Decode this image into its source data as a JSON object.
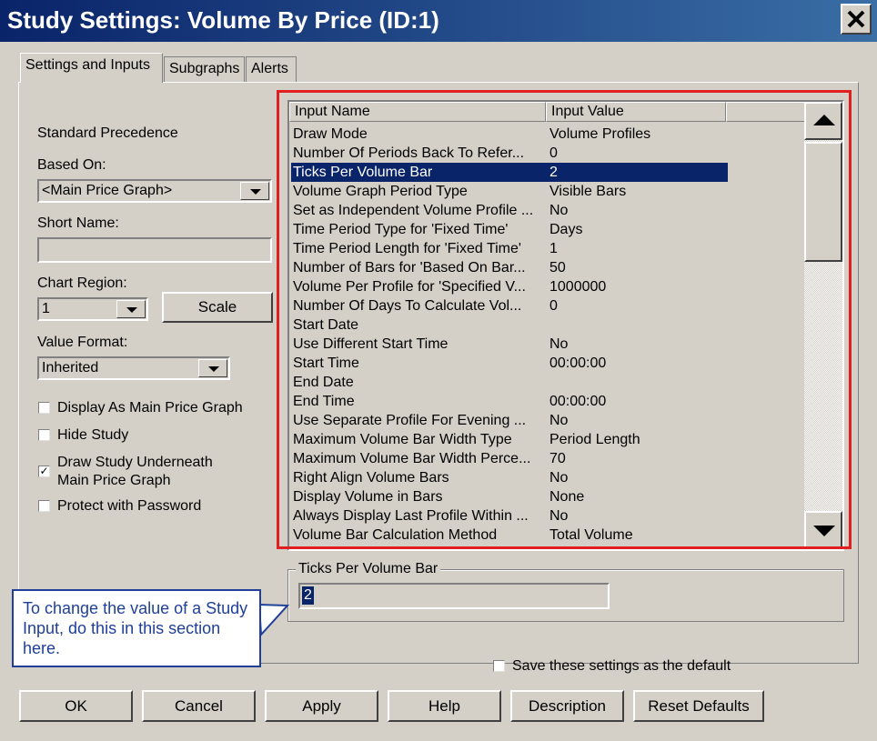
{
  "window": {
    "title": "Study Settings: Volume By Price (ID:1)",
    "close_glyph": "✕"
  },
  "tabs": [
    {
      "label": "Settings and Inputs",
      "active": true
    },
    {
      "label": "Subgraphs",
      "active": false
    },
    {
      "label": "Alerts",
      "active": false
    }
  ],
  "left": {
    "standard_precedence": "Standard Precedence",
    "based_on_label": "Based On:",
    "based_on_value": "<Main Price Graph>",
    "short_name_label": "Short Name:",
    "short_name_value": "",
    "chart_region_label": "Chart Region:",
    "chart_region_value": "1",
    "scale_label": "Scale",
    "value_format_label": "Value Format:",
    "value_format_value": "Inherited",
    "checkboxes": [
      {
        "label": "Display As Main Price Graph",
        "checked": false
      },
      {
        "label": "Hide Study",
        "checked": false
      },
      {
        "label": "Draw Study Underneath",
        "label2": "Main Price Graph",
        "checked": true
      },
      {
        "label": "Protect with Password",
        "checked": false
      }
    ],
    "check_glyph": "✓"
  },
  "grid": {
    "headers": [
      "Input Name",
      "Input Value"
    ],
    "rows": [
      {
        "name": "Draw Mode",
        "value": "Volume Profiles"
      },
      {
        "name": "Number Of Periods Back To Refer...",
        "value": "0"
      },
      {
        "name": "Ticks Per Volume Bar",
        "value": "2",
        "selected": true
      },
      {
        "name": "Volume Graph Period Type",
        "value": "Visible Bars"
      },
      {
        "name": "Set as Independent Volume Profile ...",
        "value": "No"
      },
      {
        "name": "Time Period Type for 'Fixed Time'",
        "value": "Days"
      },
      {
        "name": "Time Period Length for 'Fixed Time'",
        "value": "1"
      },
      {
        "name": "Number of Bars for 'Based On Bar...",
        "value": "50"
      },
      {
        "name": "Volume Per Profile for 'Specified V...",
        "value": "1000000"
      },
      {
        "name": "Number Of Days To Calculate Vol...",
        "value": "0"
      },
      {
        "name": "Start Date",
        "value": ""
      },
      {
        "name": "Use Different Start Time",
        "value": "No"
      },
      {
        "name": "Start Time",
        "value": "00:00:00"
      },
      {
        "name": "End Date",
        "value": ""
      },
      {
        "name": "End Time",
        "value": "00:00:00"
      },
      {
        "name": "Use Separate Profile For Evening ...",
        "value": "No"
      },
      {
        "name": "Maximum Volume Bar Width Type",
        "value": "Period Length"
      },
      {
        "name": "Maximum Volume Bar Width Perce...",
        "value": "70"
      },
      {
        "name": "Right Align Volume Bars",
        "value": "No"
      },
      {
        "name": "Display Volume in Bars",
        "value": "None"
      },
      {
        "name": "Always Display Last Profile Within ...",
        "value": "No"
      },
      {
        "name": "Volume Bar Calculation Method",
        "value": "Total Volume"
      }
    ],
    "scroll_up_icon": "triangle-up",
    "scroll_down_icon": "triangle-down"
  },
  "editor": {
    "title": "Ticks Per Volume Bar",
    "value": "2"
  },
  "callout": {
    "text": "To change the value of a Study Input, do this in this section here."
  },
  "save_default_label": "Save these settings as the default",
  "buttons": [
    "OK",
    "Cancel",
    "Apply",
    "Help",
    "Description",
    "Reset Defaults"
  ],
  "colors": {
    "title_bar": "#0a246a",
    "selection": "#0a246a",
    "highlight_box": "#e02020",
    "callout_text": "#1f3f99"
  }
}
